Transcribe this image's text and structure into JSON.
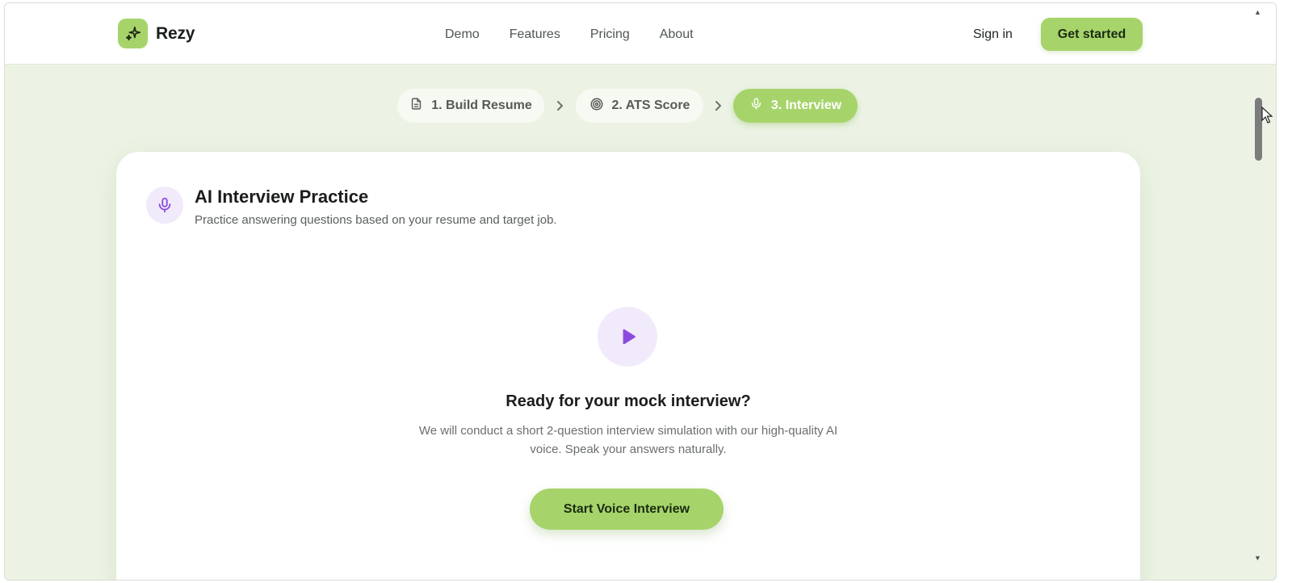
{
  "header": {
    "brand": "Rezy",
    "nav": [
      "Demo",
      "Features",
      "Pricing",
      "About"
    ],
    "sign_in": "Sign in",
    "get_started": "Get started"
  },
  "stepper": {
    "steps": [
      {
        "label": "1. Build Resume",
        "icon": "document-icon",
        "active": false
      },
      {
        "label": "2. ATS Score",
        "icon": "target-icon",
        "active": false
      },
      {
        "label": "3. Interview",
        "icon": "microphone-icon",
        "active": true
      }
    ]
  },
  "card": {
    "title": "AI Interview Practice",
    "subtitle": "Practice answering questions based on your resume and target job.",
    "ready_title": "Ready for your mock interview?",
    "ready_desc": "We will conduct a short 2-question interview simulation with our high-quality AI voice. Speak your answers naturally.",
    "start_button": "Start Voice Interview"
  },
  "colors": {
    "accent": "#a6d46a",
    "background": "#ecf3e4",
    "purple": "#8b4be0",
    "purple_bg": "#f1eafb"
  }
}
